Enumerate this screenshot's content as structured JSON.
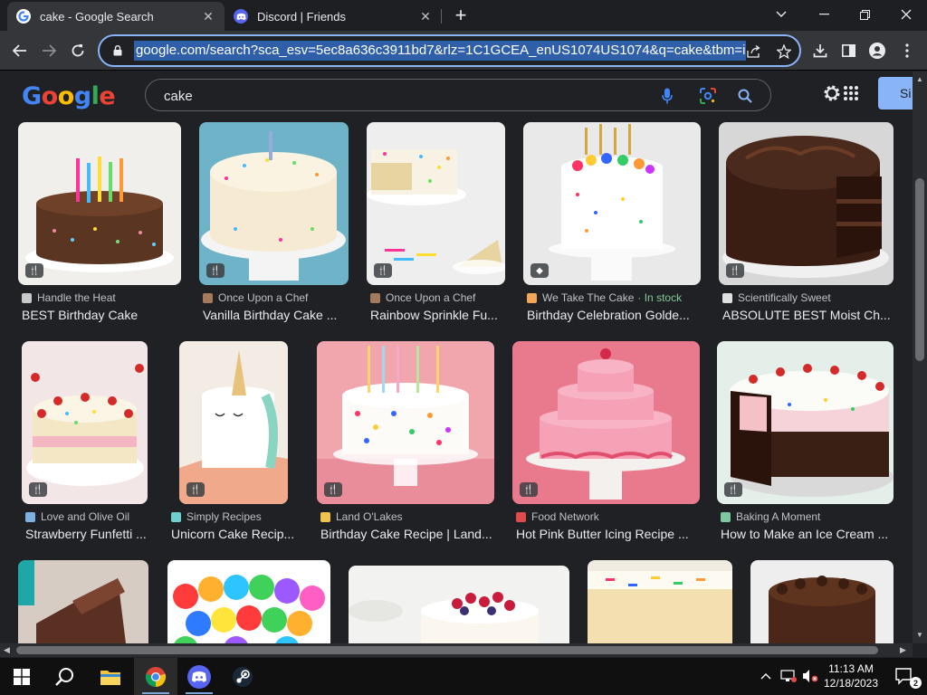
{
  "browser": {
    "tabs": [
      {
        "title": "cake - Google Search",
        "active": true,
        "icon": "google-icon"
      },
      {
        "title": "Discord | Friends",
        "active": false,
        "icon": "discord-icon"
      }
    ],
    "url": "google.com/search?sca_esv=5ec8a636c3911bd7&rlz=1C1GCEA_enUS1074US1074&q=cake&tbm=isch&source",
    "accent": "#8ab4f8"
  },
  "google": {
    "logo_text": "Google",
    "query": "cake",
    "signin_label": "Si"
  },
  "results": [
    {
      "source": "Handle the Heat",
      "title": "BEST Birthday Cake",
      "badge": "recipe",
      "src_color": "#c9c9c9"
    },
    {
      "source": "Once Upon a Chef",
      "title": "Vanilla Birthday Cake ...",
      "badge": "recipe",
      "src_color": "#a37b5c"
    },
    {
      "source": "Once Upon a Chef",
      "title": "Rainbow Sprinkle Fu...",
      "badge": "recipe",
      "src_color": "#a37b5c"
    },
    {
      "source": "We Take The Cake",
      "stock": "· In stock",
      "title": "Birthday Celebration Golde...",
      "badge": "product",
      "src_color": "#f2a65a"
    },
    {
      "source": "Scientifically Sweet",
      "title": "ABSOLUTE BEST Moist Ch...",
      "badge": "recipe",
      "src_color": "#e0e0e0"
    },
    {
      "source": "Love and Olive Oil",
      "title": "Strawberry Funfetti ...",
      "badge": "recipe",
      "src_color": "#7fb1e0"
    },
    {
      "source": "Simply Recipes",
      "title": "Unicorn Cake Recip...",
      "badge": "recipe",
      "src_color": "#6fcfcf"
    },
    {
      "source": "Land O'Lakes",
      "title": "Birthday Cake Recipe | Land...",
      "badge": "recipe",
      "src_color": "#f2c14e"
    },
    {
      "source": "Food Network",
      "title": "Hot Pink Butter Icing Recipe ...",
      "badge": "recipe",
      "src_color": "#e04b4b"
    },
    {
      "source": "Baking A Moment",
      "title": "How to Make an Ice Cream ...",
      "badge": "recipe",
      "src_color": "#7ec8a0"
    }
  ],
  "taskbar": {
    "time": "11:13 AM",
    "date": "12/18/2023",
    "notification_count": "2",
    "apps": [
      "windows-start",
      "search",
      "file-explorer",
      "chrome",
      "discord",
      "steam"
    ]
  }
}
